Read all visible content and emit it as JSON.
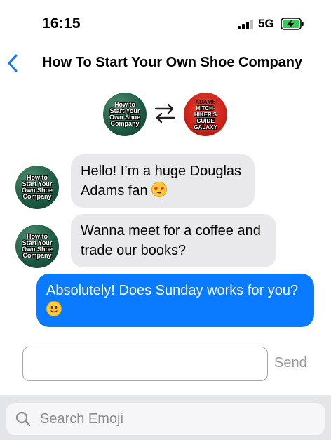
{
  "status_bar": {
    "time": "16:15",
    "network": "5G",
    "icons": [
      "signal-icon",
      "battery-charging-icon"
    ]
  },
  "header": {
    "title": "How To Start Your Own Shoe Company",
    "back_icon": "chevron-left-icon"
  },
  "book_pair": {
    "left_book": {
      "cover_text": [
        "How to",
        "Start Your",
        "Own Shoe",
        "Company"
      ]
    },
    "right_book": {
      "cover_text": [
        "ADAMS",
        "HITCH-",
        "HIKER'S",
        "GUIDE",
        "GALAXY"
      ]
    },
    "swap_icon": "swap-arrows-icon"
  },
  "messages": [
    {
      "from": "them",
      "text": "Hello! I’m a huge Douglas Adams fan",
      "emoji": "star-struck-emoji"
    },
    {
      "from": "them",
      "text": "Wanna meet for a coffee and trade our books?"
    },
    {
      "from": "me",
      "text": "Absolutely! Does Sunday works for you?",
      "emoji": "slightly-smiling-face-emoji"
    }
  ],
  "composer": {
    "value": "",
    "send_label": "Send"
  },
  "emoji_search": {
    "placeholder": "Search Emoji"
  },
  "colors": {
    "accent": "#0a7bff",
    "incoming_bubble": "#e9e9eb",
    "send_disabled": "#9a9a9a",
    "panel_bg": "#e3e5e9"
  }
}
